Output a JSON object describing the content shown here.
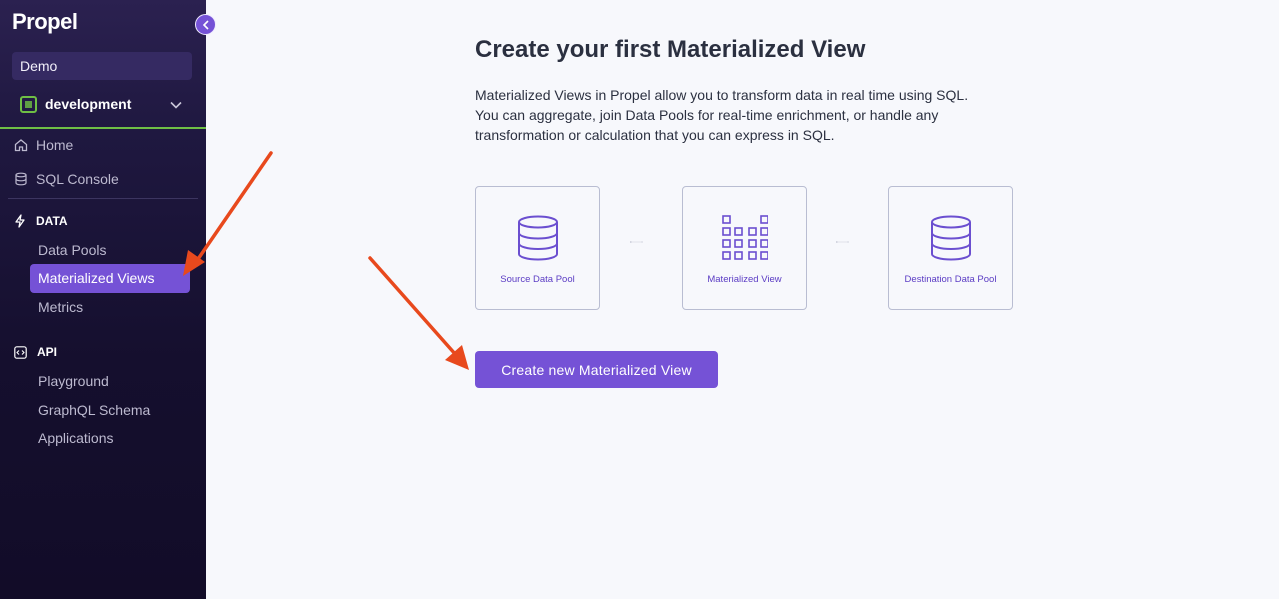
{
  "sidebar": {
    "logo": "Propel",
    "org_name": "Demo",
    "environment": "development",
    "nav": {
      "home": "Home",
      "sql_console": "SQL Console"
    },
    "data_section": {
      "title": "DATA",
      "items": [
        "Data Pools",
        "Materialized Views",
        "Metrics"
      ],
      "active": "Materialized Views"
    },
    "api_section": {
      "title": "API",
      "items": [
        "Playground",
        "GraphQL Schema",
        "Applications"
      ]
    }
  },
  "main": {
    "title": "Create your first Materialized View",
    "description_lines": [
      "Materialized Views in Propel allow you to transform data in real time using SQL.",
      "You can aggregate, join Data Pools for real-time enrichment, or handle any",
      "transformation or calculation that you can express in SQL."
    ],
    "diagram": {
      "source": "Source Data Pool",
      "view": "Materialized View",
      "destination": "Destination Data Pool"
    },
    "cta_label": "Create new Materialized View"
  },
  "colors": {
    "accent": "#7552d6",
    "env_green": "#6fbf45",
    "annotation_arrow": "#e8491d",
    "sidebar_bg": "#150f2e"
  }
}
